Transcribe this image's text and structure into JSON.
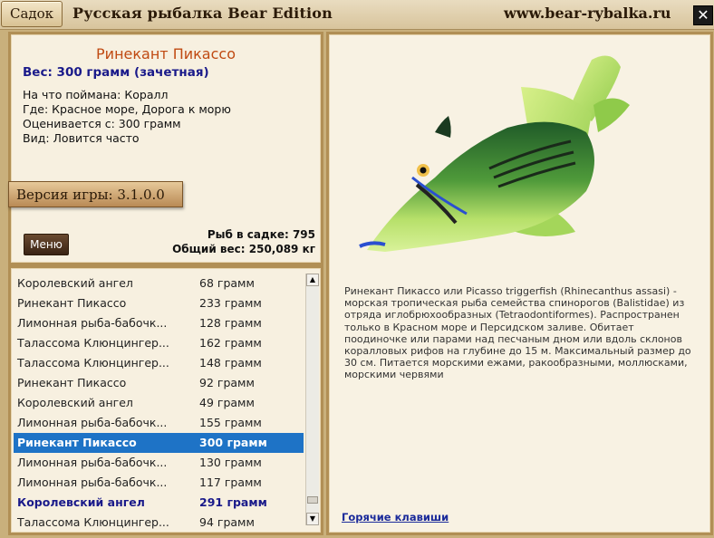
{
  "titlebar": {
    "tab_label": "Садок",
    "title": "Русская рыбалка Bear Edition",
    "site": "www.bear-rybalka.ru",
    "close_icon": "close-icon"
  },
  "info": {
    "fish_name": "Ринекант Пикассо",
    "weight": "Вес: 300 грамм (зачетная)",
    "caught_on": "На что поймана: Коралл",
    "where": "Где: Красное море, Дорога к морю",
    "valued_from": "Оценивается с: 300 грамм",
    "kind": "Вид: Ловится часто",
    "version": "Версия игры: 3.1.0.0",
    "fish_count": "Рыб в садке: 795",
    "total_weight": "Общий вес: 250,089 кг",
    "menu_label": "Меню"
  },
  "list": {
    "rows": [
      {
        "name": "Королевский ангел",
        "weight": "68 грамм"
      },
      {
        "name": "Ринекант Пикассо",
        "weight": "233 грамм"
      },
      {
        "name": "Лимонная рыба-бабочк...",
        "weight": "128 грамм"
      },
      {
        "name": "Талассома Клюнцингер...",
        "weight": "162 грамм"
      },
      {
        "name": "Талассома Клюнцингер...",
        "weight": "148 грамм"
      },
      {
        "name": "Ринекант Пикассо",
        "weight": "92 грамм"
      },
      {
        "name": "Королевский ангел",
        "weight": "49 грамм"
      },
      {
        "name": "Лимонная рыба-бабочк...",
        "weight": "155 грамм"
      },
      {
        "name": "Ринекант Пикассо",
        "weight": "300 грамм"
      },
      {
        "name": "Лимонная рыба-бабочк...",
        "weight": "130 грамм"
      },
      {
        "name": "Лимонная рыба-бабочк...",
        "weight": "117 грамм"
      },
      {
        "name": "Королевский ангел",
        "weight": "291 грамм"
      },
      {
        "name": "Талассома Клюнцингер...",
        "weight": "94 грамм"
      }
    ],
    "selected_index": 8,
    "highlighted_index": 11
  },
  "detail": {
    "description": "Ринекант Пикассо или Picasso triggerfish (Rhinecanthus assasi) - морская тропическая рыба семейства спинорогов (Balistidae) из отряда иглобрюхообразных (Tetraodontiformes). Распространен только в Красном море и Персидском заливе. Обитает поодиночке или парами над песчаным дном или вдоль склонов коралловых рифов на глубине до 15 м. Максимальный размер до 30 см. Питается морскими ежами, ракообразными, моллюсками, морскими червями",
    "hotkeys_link": "Горячие клавиши"
  },
  "colors": {
    "selected_row": "#1e73c6",
    "fish_name": "#c04a12",
    "weight_text": "#1a1a8a"
  }
}
